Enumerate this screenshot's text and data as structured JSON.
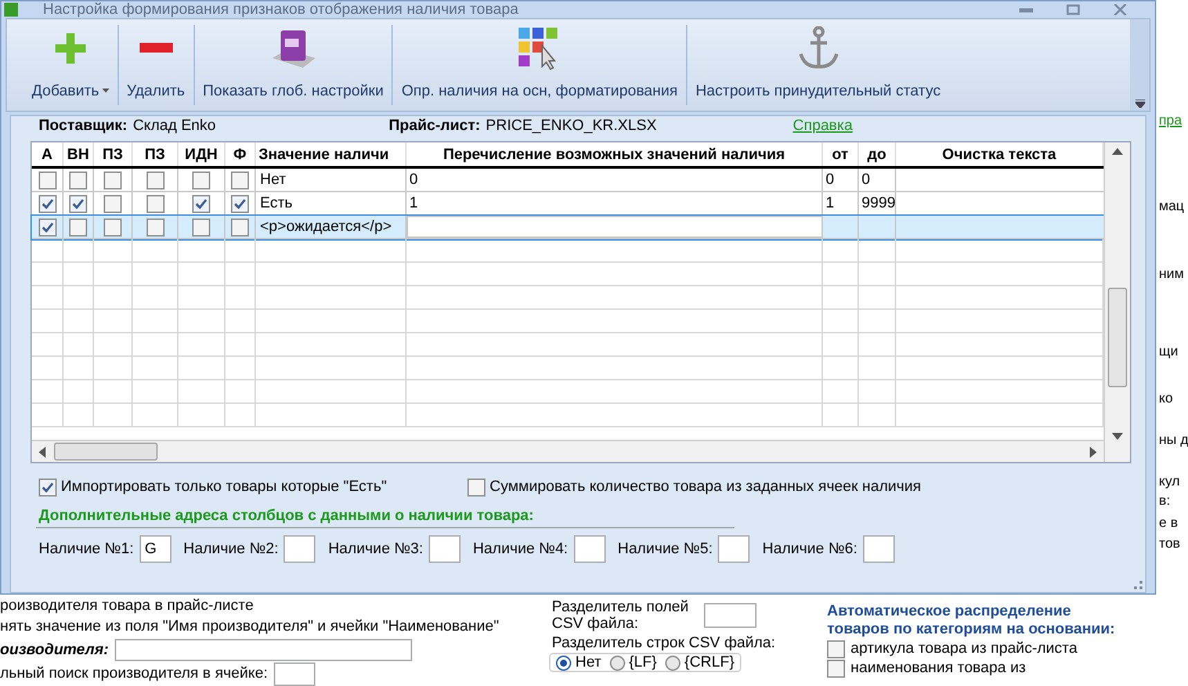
{
  "window": {
    "title": "Настройка формирования признаков отображения наличия товара"
  },
  "toolbar": {
    "buttons": [
      {
        "label": "Добавить",
        "kind": "add",
        "dropdown": true
      },
      {
        "label": "Удалить",
        "kind": "delete",
        "dropdown": false
      },
      {
        "label": "Показать глоб. настройки",
        "kind": "book",
        "dropdown": false
      },
      {
        "label": "Опр. наличия на осн, форматирования",
        "kind": "palette",
        "dropdown": false
      },
      {
        "label": "Настроить принудительный статус",
        "kind": "anchor",
        "dropdown": false
      }
    ]
  },
  "info": {
    "supplier_label": "Поставщик:",
    "supplier": "Склад Enko",
    "pricelist_label": "Прайс-лист:",
    "pricelist": "PRICE_ENKO_KR.XLSX",
    "help_link": "Справка"
  },
  "table": {
    "columns": [
      "А",
      "ВН",
      "ПЗ",
      "ПЗ",
      "ИДН",
      "Ф",
      "Значение наличи",
      "Перечисление возможных значений наличия",
      "от",
      "до",
      "Очистка текста"
    ],
    "rows": [
      {
        "flags": [
          false,
          false,
          false,
          false,
          false,
          false
        ],
        "value": "Нет",
        "values_list": "0",
        "from": "0",
        "to": "0",
        "selected": false
      },
      {
        "flags": [
          true,
          true,
          false,
          false,
          true,
          true
        ],
        "value": "Есть",
        "values_list": "1",
        "from": "1",
        "to": "9999",
        "selected": false
      },
      {
        "flags": [
          true,
          false,
          false,
          false,
          false,
          false
        ],
        "value": "<p>ожидается</p>",
        "selected": true
      }
    ]
  },
  "options": [
    {
      "label": "Импортировать только товары которые \"Есть\"",
      "checked": true
    },
    {
      "label": "Суммировать количество товара из заданных ячеек наличия",
      "checked": false
    }
  ],
  "extra_columns": {
    "title": "Дополнительные адреса столбцов с данными о наличии товара:",
    "fields": [
      {
        "label": "Наличие №1:",
        "value": "G"
      },
      {
        "label": "Наличие №2:"
      },
      {
        "label": "Наличие №3:"
      },
      {
        "label": "Наличие №4:"
      },
      {
        "label": "Наличие №5:"
      },
      {
        "label": "Наличие №6:"
      }
    ]
  },
  "background": {
    "right_fragments": [
      {
        "text": "пра",
        "kind": "link"
      },
      {
        "text": "мац",
        "kind": "text"
      },
      {
        "text": "ним",
        "kind": "text"
      },
      {
        "text": "щи",
        "kind": "text"
      },
      {
        "text": "ко",
        "kind": "text"
      },
      {
        "text": "ны д",
        "kind": "text"
      },
      {
        "text": "кул",
        "kind": "text"
      },
      {
        "text": "в:",
        "kind": "text"
      },
      {
        "text": "е в",
        "kind": "text"
      },
      {
        "text": "тов",
        "kind": "text"
      }
    ],
    "left_lines": [
      {
        "text": "роизводителя товара в прайс-листе",
        "kind": "text"
      },
      {
        "text": "нять значение из поля \"Имя производителя\" и ячейки \"Наименование\"",
        "kind": "text"
      },
      {
        "text": "оизводителя:",
        "kind": "field"
      },
      {
        "text": "льный поиск производителя в ячейке:",
        "kind": "small_field"
      }
    ],
    "csv": {
      "fields_label": "Разделитель полей CSV файла:",
      "rows_label": "Разделитель строк CSV файла:",
      "radios": [
        {
          "label": "Нет",
          "selected": true
        },
        {
          "label": "{LF}",
          "selected": false
        },
        {
          "label": "{CRLF}",
          "selected": false
        }
      ]
    },
    "auto": {
      "title": "Автоматическое распределение товаров по категориям на основании:",
      "options": [
        {
          "label": "артикула товара из прайс-листа",
          "checked": false
        },
        {
          "label": "наименования товара из",
          "checked": false
        }
      ]
    }
  }
}
